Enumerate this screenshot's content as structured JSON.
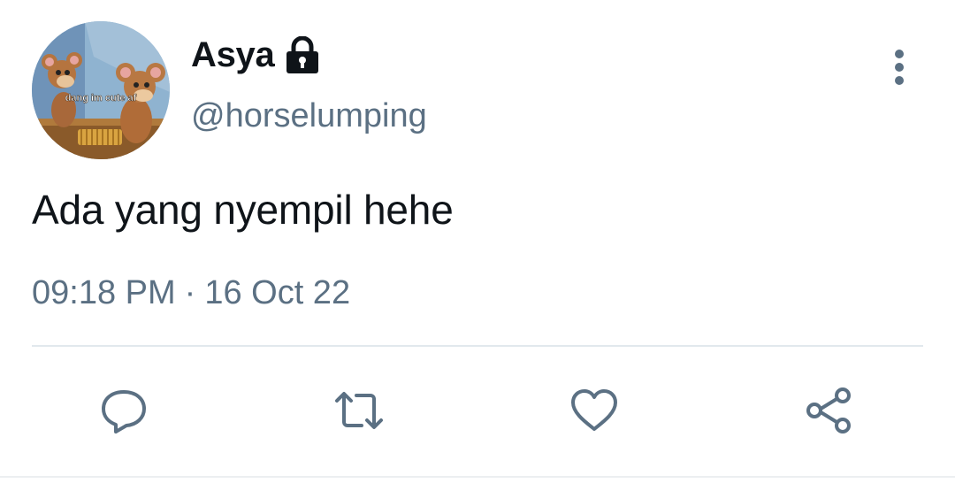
{
  "user": {
    "display_name": "Asya",
    "handle": "@horselumping",
    "protected": true,
    "avatar_caption": "dang im cute af"
  },
  "tweet": {
    "text": "Ada yang nyempil hehe",
    "time": "09:18 PM",
    "separator": "·",
    "date": "16 Oct 22"
  },
  "actions": {
    "reply_icon": "reply-icon",
    "retweet_icon": "retweet-icon",
    "like_icon": "heart-icon",
    "share_icon": "share-icon",
    "more_icon": "more-vertical-icon"
  },
  "colors": {
    "text_primary": "#0f1419",
    "text_secondary": "#5b7083",
    "divider": "#e1e8ed"
  }
}
